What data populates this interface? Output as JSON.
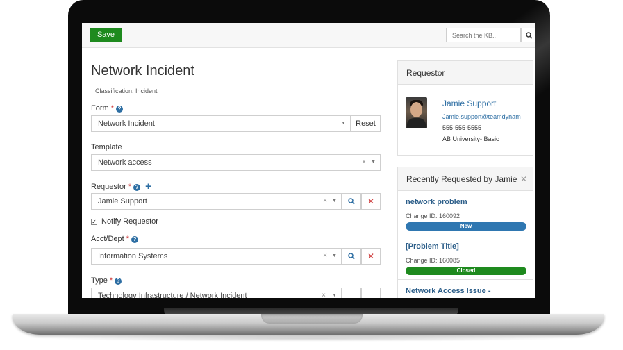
{
  "toolbar": {
    "save_label": "Save",
    "search_placeholder": "Search the KB.."
  },
  "form": {
    "title": "Network Incident",
    "classification": "Classification: Incident",
    "form_field": {
      "label": "Form",
      "required": "*",
      "value": "Network Incident",
      "reset_label": "Reset"
    },
    "template_field": {
      "label": "Template",
      "value": "Network access"
    },
    "requestor_field": {
      "label": "Requestor",
      "required": "*",
      "value": "Jamie Support"
    },
    "notify": {
      "label": "Notify Requestor",
      "checked": true
    },
    "acct_field": {
      "label": "Acct/Dept",
      "required": "*",
      "value": "Information Systems"
    },
    "type_field": {
      "label": "Type",
      "required": "*",
      "value": "Technology Infrastructure / Network Incident"
    }
  },
  "requestor_panel": {
    "title": "Requestor",
    "name": "Jamie Support",
    "email": "Jamie.support@teamdynam",
    "phone": "555-555-5555",
    "org": "AB University- Basic"
  },
  "recent_panel": {
    "title": "Recently Requested by Jamie",
    "items": [
      {
        "title": "network problem",
        "change_id": "Change ID: 160092",
        "status": "New",
        "status_color": "#2f77b1"
      },
      {
        "title": "[Problem Title]",
        "change_id": "Change ID: 160085",
        "status": "Closed",
        "status_color": "#1e8a1e"
      },
      {
        "title": "Network Access Issue -",
        "change_id": "",
        "status": "",
        "status_color": ""
      }
    ]
  },
  "colors": {
    "accent": "#2d6ea3",
    "save": "#1e8a1e",
    "required": "#cc3333"
  }
}
